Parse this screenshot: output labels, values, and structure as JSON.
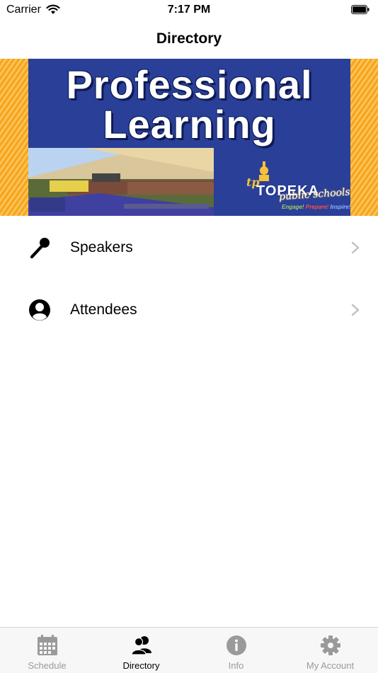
{
  "status_bar": {
    "carrier": "Carrier",
    "time": "7:17 PM"
  },
  "nav": {
    "title": "Directory"
  },
  "banner": {
    "title_line1": "Professional",
    "title_line2": "Learning",
    "logo_word": "TOPEKA",
    "logo_sub": "public schools",
    "tagline_1": "Engage!",
    "tagline_2": "Prepare!",
    "tagline_3": "Inspire!"
  },
  "list": {
    "items": [
      {
        "label": "Speakers",
        "icon": "microphone-icon"
      },
      {
        "label": "Attendees",
        "icon": "person-circle-icon"
      }
    ]
  },
  "tab_bar": {
    "active": "Directory",
    "tabs": [
      {
        "label": "Schedule",
        "icon": "calendar-icon"
      },
      {
        "label": "Directory",
        "icon": "people-icon"
      },
      {
        "label": "Info",
        "icon": "info-icon"
      },
      {
        "label": "My Account",
        "icon": "gear-icon"
      }
    ]
  },
  "colors": {
    "banner_blue": "#2a3f97",
    "banner_orange": "#f7a520",
    "inactive_tab": "#9a9a9a",
    "chevron": "#c4c4c7"
  }
}
